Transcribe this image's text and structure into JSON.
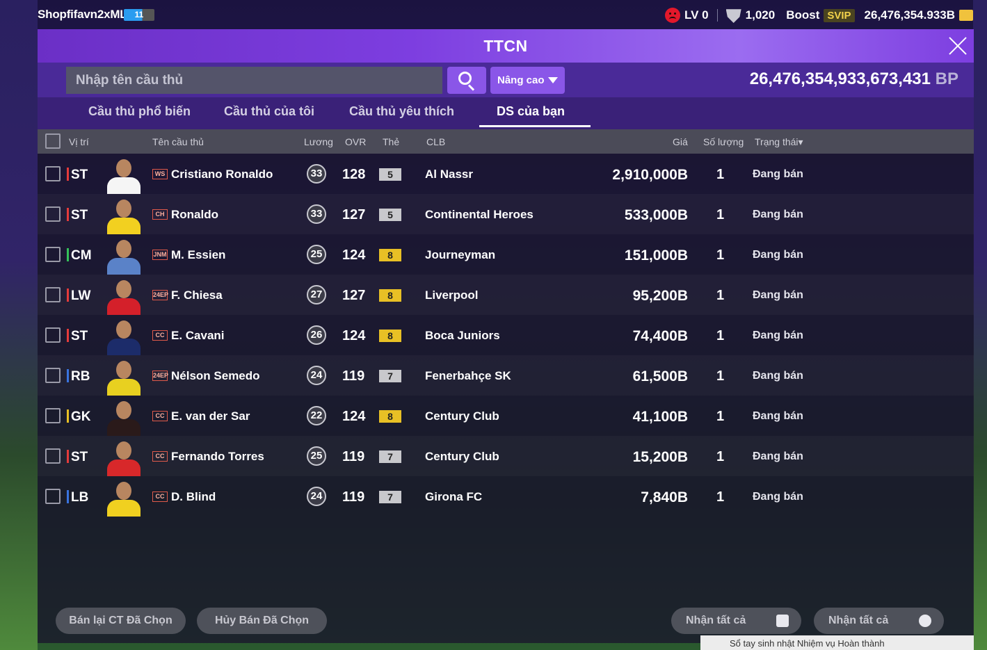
{
  "topbar": {
    "username": "Shopfifavn2xML",
    "level_badge": "11",
    "lv_label": "LV 0",
    "shield_count": "1,020",
    "boost_label": "Boost",
    "svip_label": "SVIP",
    "coins": "26,476,354.933B"
  },
  "panel": {
    "title": "TTCN",
    "search_placeholder": "Nhập tên cầu thủ",
    "advanced_label": "Nâng cao",
    "bp_value": "26,476,354,933,673,431",
    "bp_unit": "BP"
  },
  "tabs": [
    {
      "label": "Cầu thủ phổ biến",
      "active": false
    },
    {
      "label": "Cầu thủ của tôi",
      "active": false
    },
    {
      "label": "Cầu thủ yêu thích",
      "active": false
    },
    {
      "label": "DS của bạn",
      "active": true
    }
  ],
  "columns": {
    "position": "Vị trí",
    "name": "Tên cầu thủ",
    "salary": "Lương",
    "ovr": "OVR",
    "card": "Thẻ",
    "club": "CLB",
    "price": "Giá",
    "qty": "Số lượng",
    "status": "Trạng thái"
  },
  "players": [
    {
      "position": "ST",
      "pos_color": "#e53b3b",
      "season": "WS",
      "name": "Cristiano Ronaldo",
      "salary": "33",
      "ovr": "128",
      "card": "5",
      "card_color": "#c8c8cc",
      "club": "Al Nassr",
      "price": "2,910,000B",
      "qty": "1",
      "status": "Đang bán",
      "kit": "#f5f5f5"
    },
    {
      "position": "ST",
      "pos_color": "#e53b3b",
      "season": "CH",
      "name": "Ronaldo",
      "salary": "33",
      "ovr": "127",
      "card": "5",
      "card_color": "#c8c8cc",
      "club": "Continental Heroes",
      "price": "533,000B",
      "qty": "1",
      "status": "Đang bán",
      "kit": "#f2d020"
    },
    {
      "position": "CM",
      "pos_color": "#35c25a",
      "season": "JNM",
      "name": "M. Essien",
      "salary": "25",
      "ovr": "124",
      "card": "8",
      "card_color": "#e8c025",
      "club": "Journeyman",
      "price": "151,000B",
      "qty": "1",
      "status": "Đang bán",
      "kit": "#5a82c8"
    },
    {
      "position": "LW",
      "pos_color": "#e53b3b",
      "season": "24EP",
      "name": "F. Chiesa",
      "salary": "27",
      "ovr": "127",
      "card": "8",
      "card_color": "#e8c025",
      "club": "Liverpool",
      "price": "95,200B",
      "qty": "1",
      "status": "Đang bán",
      "kit": "#d4202a"
    },
    {
      "position": "ST",
      "pos_color": "#e53b3b",
      "season": "CC",
      "name": "E. Cavani",
      "salary": "26",
      "ovr": "124",
      "card": "8",
      "card_color": "#e8c025",
      "club": "Boca Juniors",
      "price": "74,400B",
      "qty": "1",
      "status": "Đang bán",
      "kit": "#1c2c6a"
    },
    {
      "position": "RB",
      "pos_color": "#3a74e0",
      "season": "24EP",
      "name": "Nélson Semedo",
      "salary": "24",
      "ovr": "119",
      "card": "7",
      "card_color": "#c8c8cc",
      "club": "Fenerbahçe SK",
      "price": "61,500B",
      "qty": "1",
      "status": "Đang bán",
      "kit": "#e8d020"
    },
    {
      "position": "GK",
      "pos_color": "#e8c025",
      "season": "CC",
      "name": "E. van der Sar",
      "salary": "22",
      "ovr": "124",
      "card": "8",
      "card_color": "#e8c025",
      "club": "Century Club",
      "price": "41,100B",
      "qty": "1",
      "status": "Đang bán",
      "kit": "#2a1a1a"
    },
    {
      "position": "ST",
      "pos_color": "#e53b3b",
      "season": "CC",
      "name": "Fernando Torres",
      "salary": "25",
      "ovr": "119",
      "card": "7",
      "card_color": "#c8c8cc",
      "club": "Century Club",
      "price": "15,200B",
      "qty": "1",
      "status": "Đang bán",
      "kit": "#d8282a"
    },
    {
      "position": "LB",
      "pos_color": "#3a74e0",
      "season": "CC",
      "name": "D. Blind",
      "salary": "24",
      "ovr": "119",
      "card": "7",
      "card_color": "#c8c8cc",
      "club": "Girona FC",
      "price": "7,840B",
      "qty": "1",
      "status": "Đang bán",
      "kit": "#f0d020"
    }
  ],
  "footer": {
    "resell_label": "Bán lại CT Đã Chọn",
    "cancel_label": "Hủy Bán Đã Chọn",
    "claim_all_1": "Nhận tất cả",
    "claim_all_2": "Nhận tất cả",
    "notice": "Sổ tay sinh nhật Nhiệm vụ Hoàn thành"
  }
}
